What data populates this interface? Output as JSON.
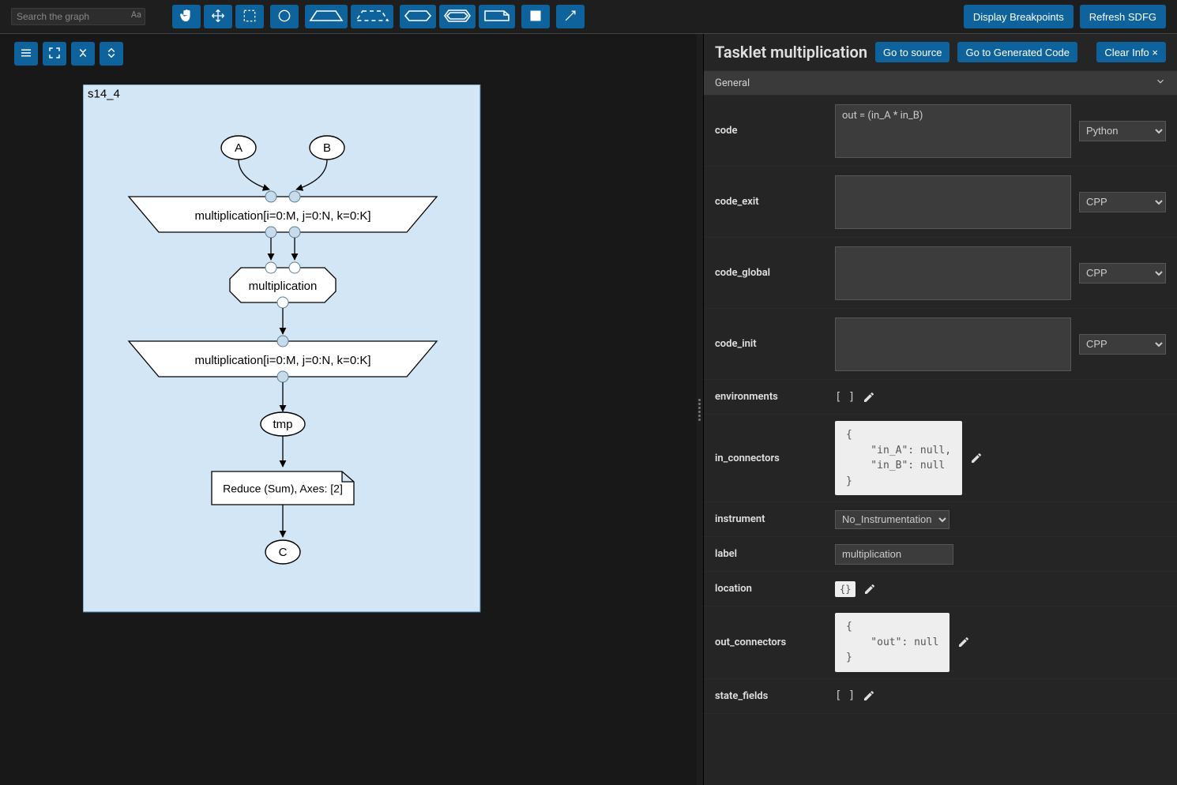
{
  "search": {
    "placeholder": "Search the graph",
    "case_btn": "Aa"
  },
  "top_buttons": {
    "display_bp": "Display Breakpoints",
    "refresh": "Refresh SDFG"
  },
  "graph": {
    "state_label": "s14_4",
    "node_A": "A",
    "node_B": "B",
    "map_entry": "multiplication[i=0:M, j=0:N, k=0:K]",
    "tasklet": "multiplication",
    "map_exit": "multiplication[i=0:M, j=0:N, k=0:K]",
    "tmp": "tmp",
    "reduce": "Reduce (Sum), Axes: [2]",
    "node_C": "C"
  },
  "inspector": {
    "title": "Tasklet multiplication",
    "btn_source": "Go to source",
    "btn_gen": "Go to Generated Code",
    "btn_clear": "Clear Info ×",
    "section": "General",
    "labels": {
      "code": "code",
      "code_exit": "code_exit",
      "code_global": "code_global",
      "code_init": "code_init",
      "environments": "environments",
      "in_connectors": "in_connectors",
      "instrument": "instrument",
      "label": "label",
      "location": "location",
      "out_connectors": "out_connectors",
      "state_fields": "state_fields"
    },
    "values": {
      "code": "out = (in_A * in_B)",
      "code_lang": "Python",
      "code_exit": "",
      "code_exit_lang": "CPP",
      "code_global": "",
      "code_global_lang": "CPP",
      "code_init": "",
      "code_init_lang": "CPP",
      "environments": "[ ]",
      "in_connectors": "{\n    \"in_A\": null,\n    \"in_B\": null\n}",
      "instrument": "No_Instrumentation",
      "label": "multiplication",
      "location": "{}",
      "out_connectors": "{\n    \"out\": null\n}",
      "state_fields": "[ ]"
    },
    "lang_options": [
      "Python",
      "CPP"
    ],
    "instrument_options": [
      "No_Instrumentation"
    ]
  }
}
